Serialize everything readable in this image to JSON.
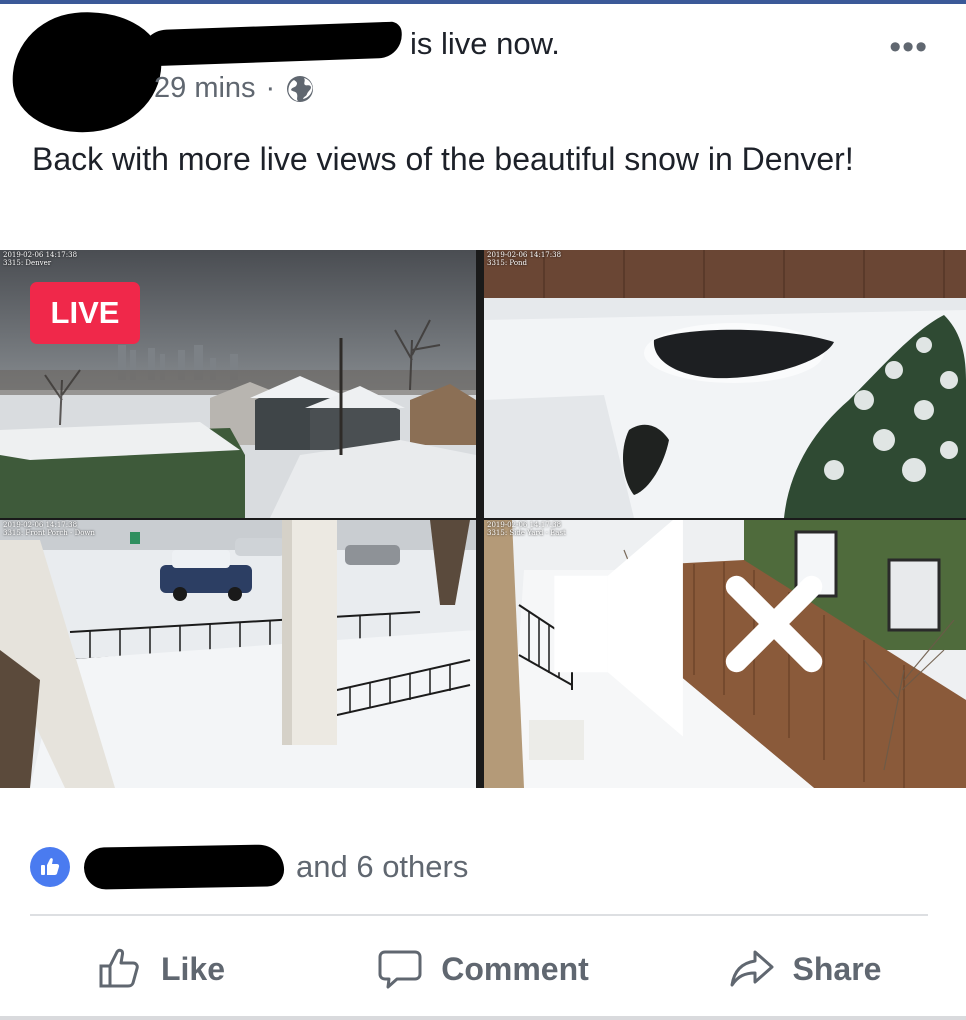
{
  "post": {
    "status_text": "is live now.",
    "time": "29 mins",
    "separator": "·",
    "privacy_icon": "globe-icon",
    "more_icon": "more-options-icon",
    "more_label": "•••",
    "body": "Back with more live views of the beautiful snow in Denver!"
  },
  "video": {
    "live_label": "LIVE",
    "mute_icon": "speaker-muted-icon",
    "cameras": [
      {
        "timestamp": "2019-02-06 14:17:38",
        "name": "3315: Denver"
      },
      {
        "timestamp": "2019-02-06 14:17:38",
        "name": "3315: Pond"
      },
      {
        "timestamp": "2019-02-06 14:17:38",
        "name": "3315: Front Porch - Down"
      },
      {
        "timestamp": "2019-02-06 14:17:38",
        "name": "3315: Side Yard - East"
      }
    ]
  },
  "reactions": {
    "icon": "like-reaction-icon",
    "text": "and 6 others"
  },
  "actions": {
    "like_label": "Like",
    "comment_label": "Comment",
    "share_label": "Share"
  },
  "colors": {
    "brand": "#3b5998",
    "live_badge": "#f0284a",
    "like_bubble": "#4a7bf0",
    "muted_text": "#606770",
    "primary_text": "#1d2129"
  }
}
